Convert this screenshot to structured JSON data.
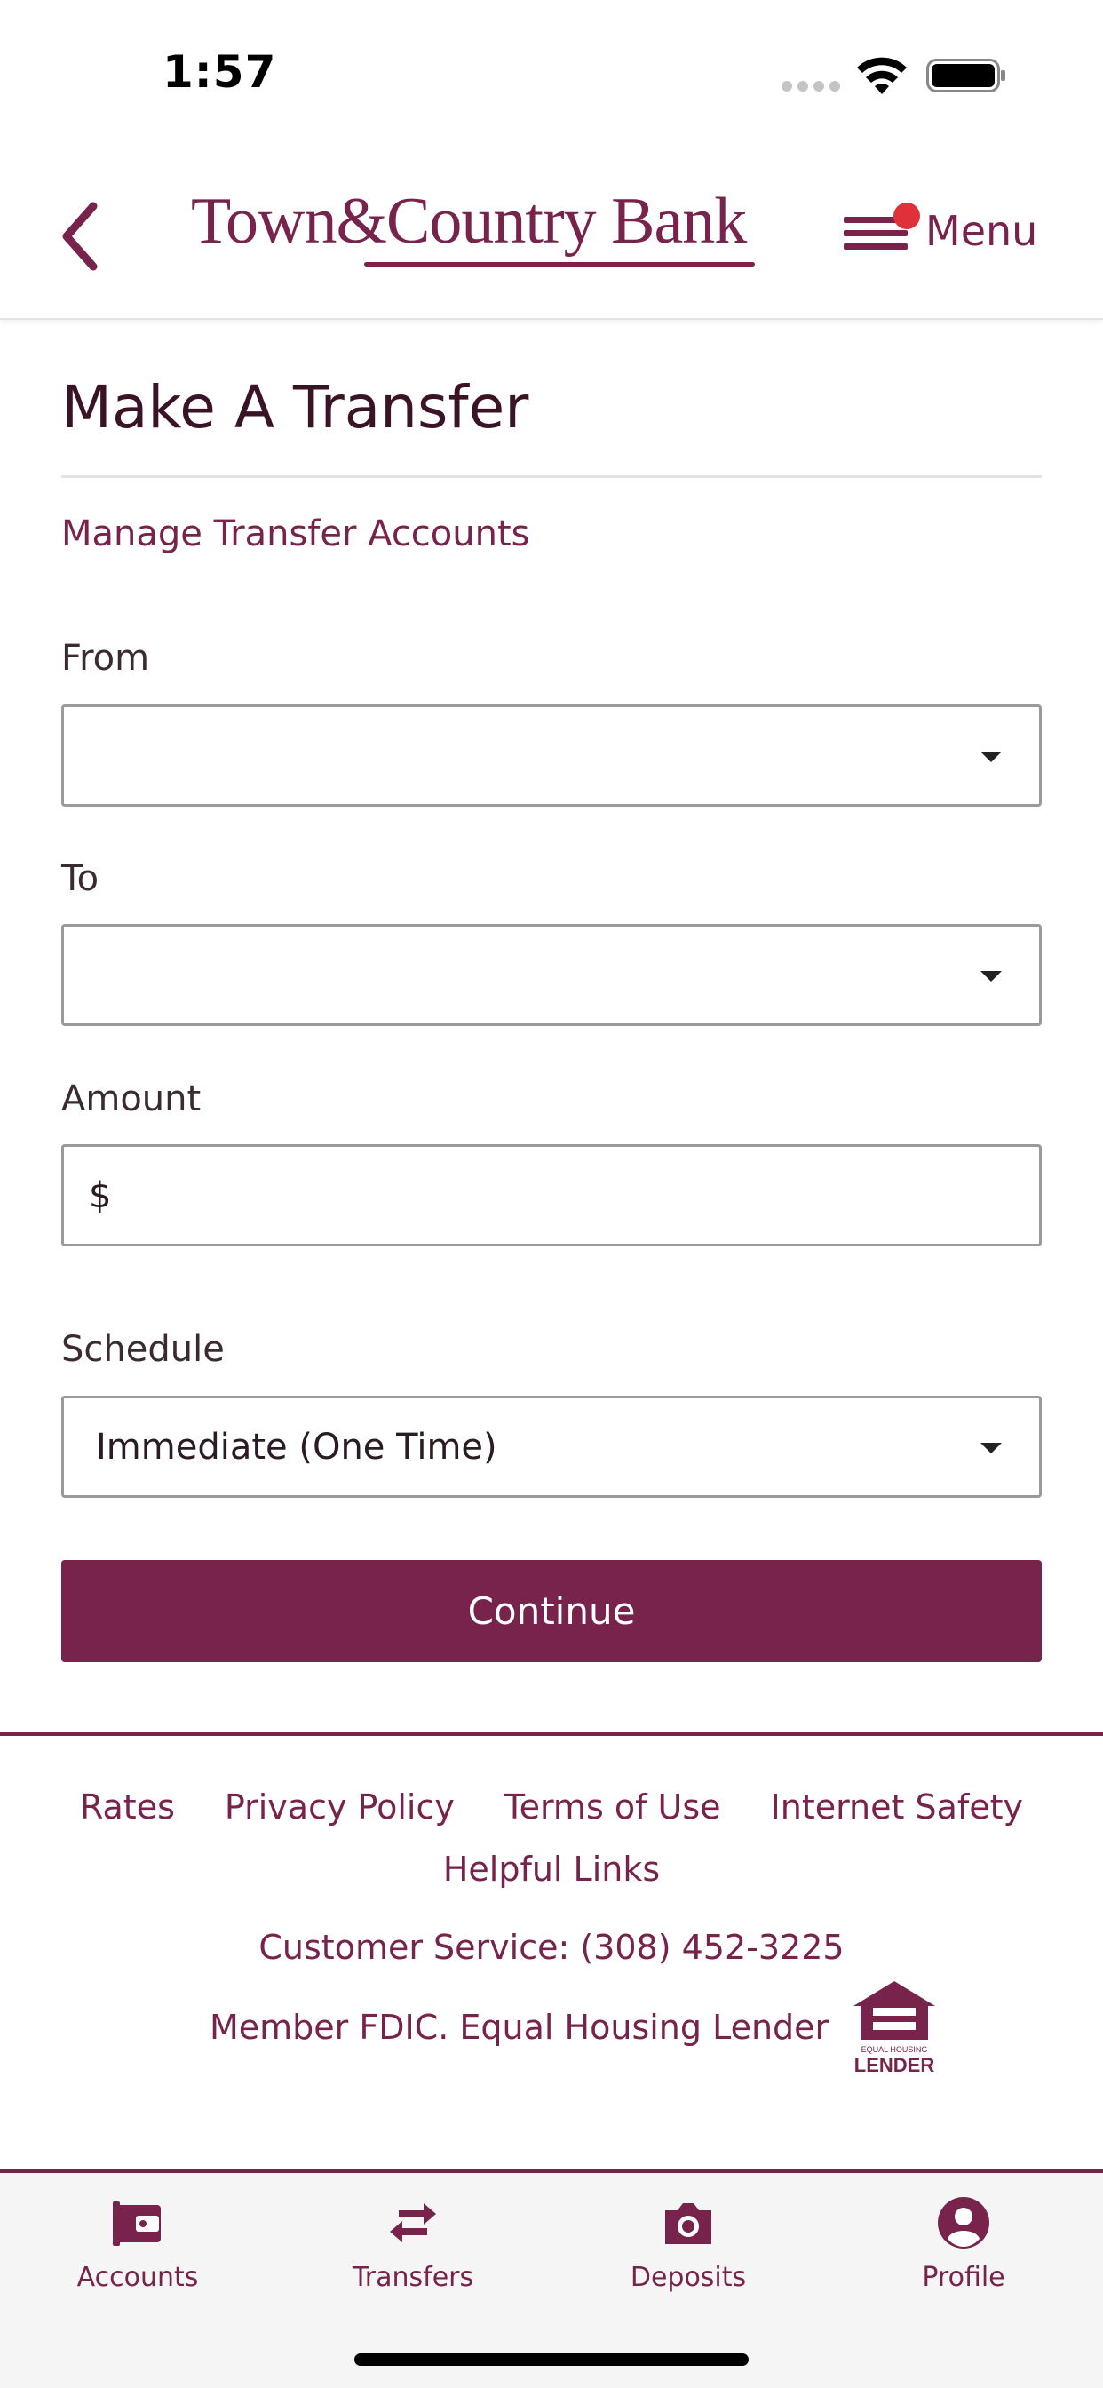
{
  "status_bar": {
    "time": "1:57"
  },
  "header": {
    "logo_text": "Town&Country Bank",
    "menu_label": "Menu"
  },
  "page": {
    "title": "Make A Transfer",
    "manage_link": "Manage Transfer Accounts"
  },
  "form": {
    "from": {
      "label": "From",
      "value": ""
    },
    "to": {
      "label": "To",
      "value": ""
    },
    "amount": {
      "label": "Amount",
      "prefix": "$",
      "value": ""
    },
    "schedule": {
      "label": "Schedule",
      "value": "Immediate (One Time)"
    },
    "continue_label": "Continue"
  },
  "footer": {
    "links": [
      "Rates",
      "Privacy Policy",
      "Terms of Use",
      "Internet Safety",
      "Helpful Links"
    ],
    "customer_service": "Customer Service: (308) 452-3225",
    "fdic": "Member FDIC. Equal Housing Lender",
    "ehl_small": "EQUAL HOUSING",
    "ehl_big": "LENDER"
  },
  "tabs": [
    {
      "label": "Accounts",
      "icon": "wallet-icon"
    },
    {
      "label": "Transfers",
      "icon": "transfer-arrows-icon"
    },
    {
      "label": "Deposits",
      "icon": "camera-icon"
    },
    {
      "label": "Profile",
      "icon": "profile-icon"
    }
  ],
  "colors": {
    "brand": "#77234b",
    "notification": "#e0303a"
  }
}
